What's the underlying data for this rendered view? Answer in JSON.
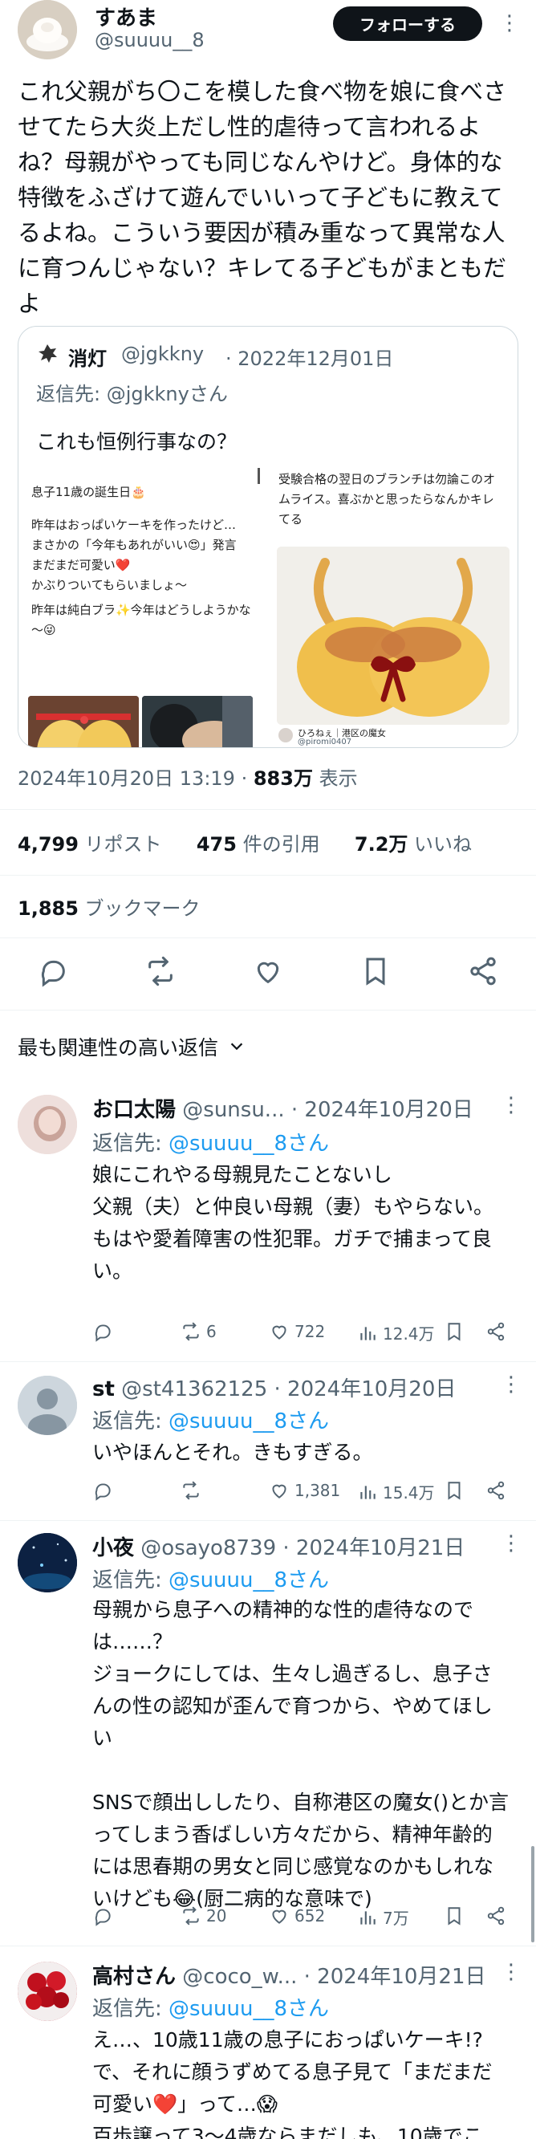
{
  "author": {
    "display_name": "すあま",
    "handle": "@suuuu__8",
    "follow_label": "フォローする",
    "more": "⋮"
  },
  "post": {
    "text": "これ父親がち〇こを模した食べ物を娘に食べさせてたら大炎上だし性的虐待って言われるよね？母親がやっても同じなんやけど。身体的な特徴をふざけて遊んでいいって子どもに教えてるよね。こういう要因が積み重なって異常な人に育つんじゃない？キレてる子どもがまともだよ"
  },
  "quote": {
    "display_name": "消灯",
    "handle": "@jgkkny",
    "date": "· 2022年12月01日",
    "reply_to_prefix": "返信先: ",
    "reply_to_handle": "@jgkknyさん",
    "text": "これも恒例行事なの？",
    "left_card_lines": [
      "息子11歳の誕生日🎂",
      "昨年はおっぱいケーキを作ったけど…",
      "まさかの「今年もあれがいい😍」発言",
      "まだまだ可愛い❤️",
      "かぶりついてもらいましょ～",
      "昨年は純白ブラ✨今年はどうしようかな～😜"
    ],
    "right_card_lines": [
      "受験合格の翌日のブランチは勿論このオムライス。喜ぶかと思ったらなんかキレてる"
    ],
    "right_card_name": "ひろねぇ｜港区の魔女",
    "right_card_handle": "@piromi0407"
  },
  "meta": {
    "timestamp": "2024年10月20日 13:19 · ",
    "views_count": "883万",
    "views_label": " 表示"
  },
  "stats": {
    "reposts_count": "4,799",
    "reposts_label": " リポスト",
    "quotes_count": "475",
    "quotes_label": " 件の引用",
    "likes_count": "7.2万",
    "likes_label": " いいね",
    "bookmarks_count": "1,885",
    "bookmarks_label": " ブックマーク"
  },
  "sort": {
    "label": "最も関連性の高い返信"
  },
  "replies": [
    {
      "name": "お口太陽",
      "handle": "@sunsu...",
      "date": "· 2024年10月20日",
      "reply_to_prefix": "返信先: ",
      "reply_to_handle": "@suuuu__8さん",
      "body": "娘にこれやる母親見たことないし\n父親（夫）と仲良い母親（妻）もやらない。\nもはや愛着障害の性犯罪。ガチで捕まって良い。",
      "reposts": "6",
      "likes": "722",
      "views": "12.4万"
    },
    {
      "name": "st",
      "handle": "@st41362125",
      "date": "· 2024年10月20日",
      "reply_to_prefix": "返信先: ",
      "reply_to_handle": "@suuuu__8さん",
      "body": "いやほんとそれ。きもすぎる。",
      "reposts": "",
      "likes": "1,381",
      "views": "15.4万"
    },
    {
      "name": "小夜",
      "handle": "@osayo8739",
      "date": "· 2024年10月21日",
      "reply_to_prefix": "返信先: ",
      "reply_to_handle": "@suuuu__8さん",
      "body": "母親から息子への精神的な性的虐待なのでは……？\nジョークにしては、生々し過ぎるし、息子さんの性の認知が歪んで育つから、やめてほしい\n\nSNSで顔出ししたり、自称港区の魔女()とか言ってしまう香ばしい方々だから、精神年齢的には思春期の男女と同じ感覚なのかもしれないけども😂(厨二病的な意味で)",
      "reposts": "20",
      "likes": "652",
      "views": "7万"
    },
    {
      "name": "高村さん",
      "handle": "@coco_w...",
      "date": "· 2024年10月21日",
      "reply_to_prefix": "返信先: ",
      "reply_to_handle": "@suuuu__8さん",
      "body": "え…、10歳11歳の息子におっぱいケーキ!?で、それに顔うずめてる息子見て「まだまだ可愛い❤️」って…😱\n百歩譲って3～4歳ならまだしも、10歳でこ",
      "reposts": "",
      "likes": "",
      "views": ""
    }
  ],
  "colors": {
    "text": "#0f1419",
    "muted": "#536471",
    "accent": "#1d9bf0",
    "border": "#cfd9de"
  }
}
